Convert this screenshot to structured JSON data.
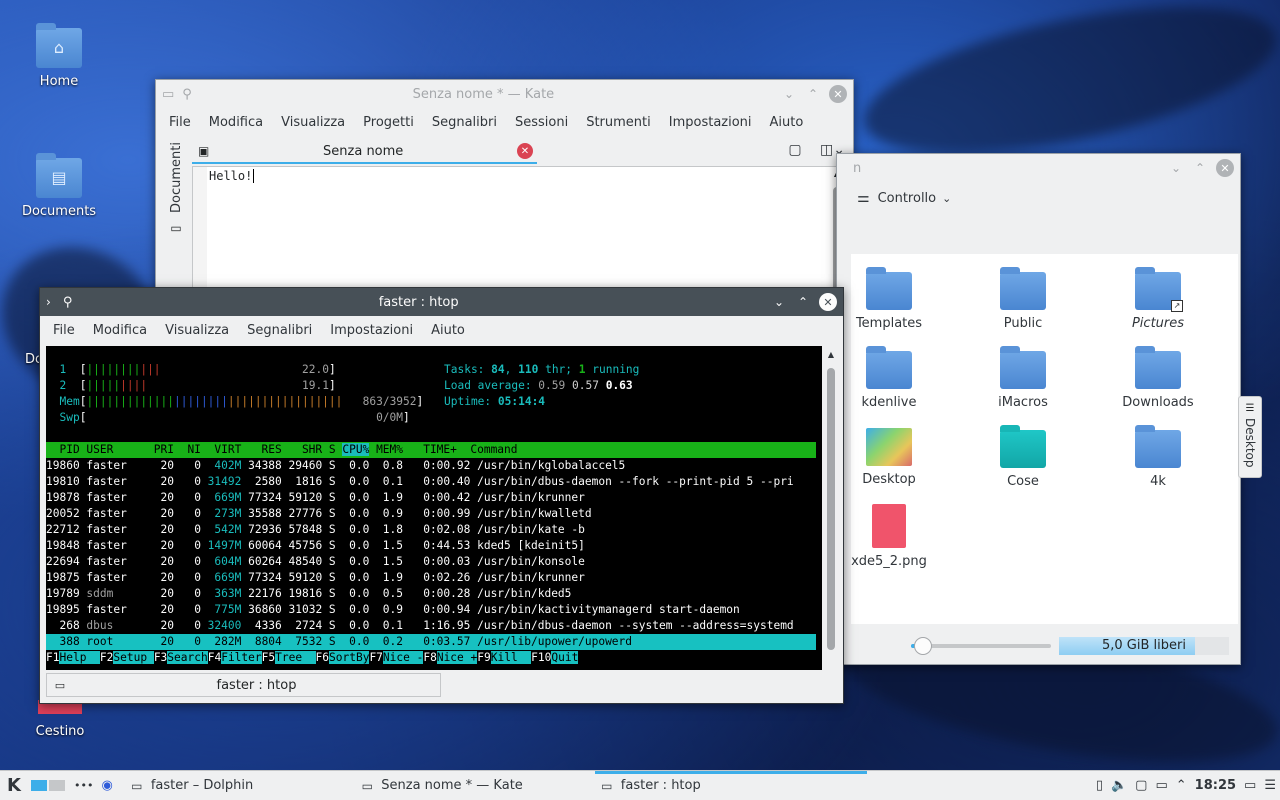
{
  "desktop": {
    "icons": [
      {
        "label": "Home",
        "icon": "home-folder-icon"
      },
      {
        "label": "Documents",
        "icon": "documents-folder-icon"
      },
      {
        "label": "Do",
        "icon": "folder-icon"
      },
      {
        "label": "Cestino",
        "icon": "trash-icon"
      }
    ]
  },
  "kate": {
    "title": "Senza nome * — Kate",
    "menu": [
      "File",
      "Modifica",
      "Visualizza",
      "Progetti",
      "Segnalibri",
      "Sessioni",
      "Strumenti",
      "Impostazioni",
      "Aiuto"
    ],
    "side_dock_label": "Documenti",
    "tab_label": "Senza nome",
    "editor_text": "Hello!"
  },
  "dolphin": {
    "title_fragment": "n",
    "toolbar_label": "Controllo",
    "items": [
      {
        "label": "Templates",
        "type": "folder"
      },
      {
        "label": "Public",
        "type": "folder"
      },
      {
        "label": "Pictures",
        "type": "folder-link"
      },
      {
        "label": "kdenlive",
        "type": "folder"
      },
      {
        "label": "iMacros",
        "type": "folder"
      },
      {
        "label": "Downloads",
        "type": "folder"
      },
      {
        "label": "Desktop",
        "type": "desktop-folder"
      },
      {
        "label": "Cose",
        "type": "teal-folder"
      },
      {
        "label": "4k",
        "type": "folder"
      },
      {
        "label": "xde5_2.png",
        "type": "png-file"
      }
    ],
    "free_space": "5,0 GiB liberi",
    "free_space_fraction": 0.8,
    "zoom_fraction": 0.05,
    "side_tab_label": "Desktop"
  },
  "konsole": {
    "title": "faster : htop",
    "menu": [
      "File",
      "Modifica",
      "Visualizza",
      "Segnalibri",
      "Impostazioni",
      "Aiuto"
    ],
    "tab_label": "faster : htop",
    "htop": {
      "cpu1_pct": "22.0",
      "cpu2_pct": "19.1",
      "mem": "863/3952",
      "swp": "0/0M",
      "tasks": "84",
      "threads": "110",
      "running": "1",
      "load1": "0.59",
      "load5": "0.57",
      "load15": "0.63",
      "uptime": "05:14:4",
      "columns": "  PID USER      PRI  NI  VIRT   RES   SHR S ",
      "col_cpu": "CPU%",
      "col_rest": " MEM%   TIME+  Command",
      "rows": [
        {
          "pid": "19860",
          "user": "faster",
          "pri": "20",
          "ni": "0",
          "virt": "402M",
          "res": "34388",
          "shr": "29460",
          "s": "S",
          "cpu": "0.0",
          "mem": "0.8",
          "time": "0:00.92",
          "cmd": "/usr/bin/kglobalaccel5"
        },
        {
          "pid": "19810",
          "user": "faster",
          "pri": "20",
          "ni": "0",
          "virt": "31492",
          "res": "2580",
          "shr": "1816",
          "s": "S",
          "cpu": "0.0",
          "mem": "0.1",
          "time": "0:00.40",
          "cmd": "/usr/bin/dbus-daemon --fork --print-pid 5 --pri"
        },
        {
          "pid": "19878",
          "user": "faster",
          "pri": "20",
          "ni": "0",
          "virt": "669M",
          "res": "77324",
          "shr": "59120",
          "s": "S",
          "cpu": "0.0",
          "mem": "1.9",
          "time": "0:00.42",
          "cmd": "/usr/bin/krunner"
        },
        {
          "pid": "20052",
          "user": "faster",
          "pri": "20",
          "ni": "0",
          "virt": "273M",
          "res": "35588",
          "shr": "27776",
          "s": "S",
          "cpu": "0.0",
          "mem": "0.9",
          "time": "0:00.99",
          "cmd": "/usr/bin/kwalletd"
        },
        {
          "pid": "22712",
          "user": "faster",
          "pri": "20",
          "ni": "0",
          "virt": "542M",
          "res": "72936",
          "shr": "57848",
          "s": "S",
          "cpu": "0.0",
          "mem": "1.8",
          "time": "0:02.08",
          "cmd": "/usr/bin/kate -b"
        },
        {
          "pid": "19848",
          "user": "faster",
          "pri": "20",
          "ni": "0",
          "virt": "1497M",
          "res": "60064",
          "shr": "45756",
          "s": "S",
          "cpu": "0.0",
          "mem": "1.5",
          "time": "0:44.53",
          "cmd": "kded5 [kdeinit5]"
        },
        {
          "pid": "22694",
          "user": "faster",
          "pri": "20",
          "ni": "0",
          "virt": "604M",
          "res": "60264",
          "shr": "48540",
          "s": "S",
          "cpu": "0.0",
          "mem": "1.5",
          "time": "0:00.03",
          "cmd": "/usr/bin/konsole"
        },
        {
          "pid": "19875",
          "user": "faster",
          "pri": "20",
          "ni": "0",
          "virt": "669M",
          "res": "77324",
          "shr": "59120",
          "s": "S",
          "cpu": "0.0",
          "mem": "1.9",
          "time": "0:02.26",
          "cmd": "/usr/bin/krunner"
        },
        {
          "pid": "19789",
          "user": "sddm",
          "pri": "20",
          "ni": "0",
          "virt": "363M",
          "res": "22176",
          "shr": "19816",
          "s": "S",
          "cpu": "0.0",
          "mem": "0.5",
          "time": "0:00.28",
          "cmd": "/usr/bin/kded5"
        },
        {
          "pid": "19895",
          "user": "faster",
          "pri": "20",
          "ni": "0",
          "virt": "775M",
          "res": "36860",
          "shr": "31032",
          "s": "S",
          "cpu": "0.0",
          "mem": "0.9",
          "time": "0:00.94",
          "cmd": "/usr/bin/kactivitymanagerd start-daemon"
        },
        {
          "pid": "268",
          "user": "dbus",
          "pri": "20",
          "ni": "0",
          "virt": "32400",
          "res": "4336",
          "shr": "2724",
          "s": "S",
          "cpu": "0.0",
          "mem": "0.1",
          "time": "1:16.95",
          "cmd": "/usr/bin/dbus-daemon --system --address=systemd"
        },
        {
          "pid": "388",
          "user": "root",
          "pri": "20",
          "ni": "0",
          "virt": "282M",
          "res": "8804",
          "shr": "7532",
          "s": "S",
          "cpu": "0.0",
          "mem": "0.2",
          "time": "0:03.57",
          "cmd": "/usr/lib/upower/upowerd"
        }
      ],
      "fkeys": [
        {
          "num": "F1",
          "label": "Help"
        },
        {
          "num": "F2",
          "label": "Setup"
        },
        {
          "num": "F3",
          "label": "Search"
        },
        {
          "num": "F4",
          "label": "Filter"
        },
        {
          "num": "F5",
          "label": "Tree"
        },
        {
          "num": "F6",
          "label": "SortBy"
        },
        {
          "num": "F7",
          "label": "Nice -"
        },
        {
          "num": "F8",
          "label": "Nice +"
        },
        {
          "num": "F9",
          "label": "Kill"
        },
        {
          "num": "F10",
          "label": "Quit"
        }
      ]
    }
  },
  "taskbar": {
    "tasks": [
      {
        "label": "faster – Dolphin",
        "icon": "dolphin-icon"
      },
      {
        "label": "Senza nome * — Kate",
        "icon": "kate-icon"
      },
      {
        "label": "faster : htop",
        "icon": "konsole-icon"
      }
    ],
    "clock": "18:25",
    "more_label": "•••"
  },
  "colors": {
    "accent": "#3daee9",
    "htop_header": "#18b218",
    "htop_selection": "#17c1c1",
    "close_red": "#da4453"
  }
}
